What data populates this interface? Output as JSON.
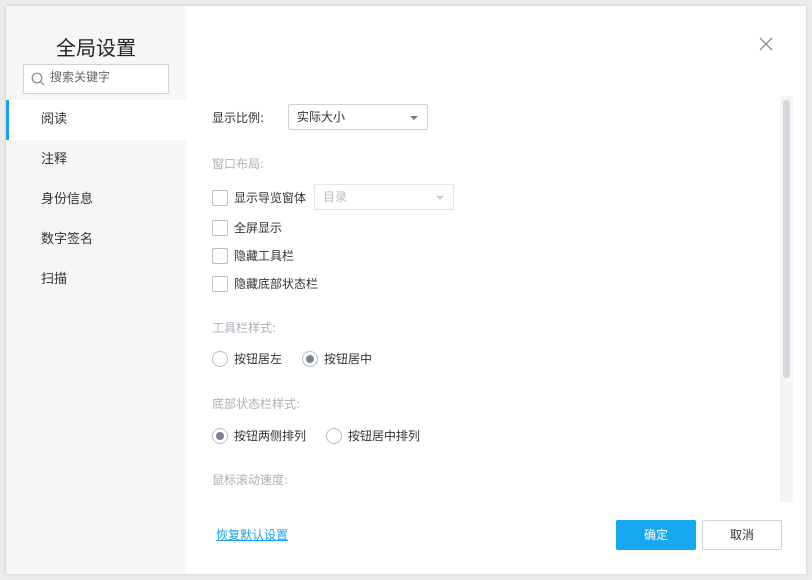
{
  "sidebar": {
    "title": "全局设置",
    "search_placeholder": "搜索关键字",
    "items": [
      {
        "label": "阅读",
        "active": true
      },
      {
        "label": "注释"
      },
      {
        "label": "身份信息"
      },
      {
        "label": "数字签名"
      },
      {
        "label": "扫描"
      }
    ]
  },
  "reading": {
    "zoom_label": "显示比例:",
    "zoom_value": "实际大小",
    "window_layout_label": "窗口布局:",
    "show_nav_pane": "显示导览窗体",
    "nav_pane_value": "目录",
    "fullscreen": "全屏显示",
    "hide_toolbar": "隐藏工具栏",
    "hide_statusbar": "隐藏底部状态栏",
    "toolbar_style_label": "工具栏样式:",
    "toolbar_left": "按钮居左",
    "toolbar_center": "按钮居中",
    "statusbar_style_label": "底部状态栏样式:",
    "status_sides": "按钮两侧排列",
    "status_center": "按钮居中排列",
    "scroll_speed_label": "鼠标滚动速度:"
  },
  "footer": {
    "restore": "恢复默认设置",
    "ok": "确定",
    "cancel": "取消"
  },
  "colors": {
    "accent": "#15a7f0",
    "sidebar_bg": "#f5f6f8"
  }
}
